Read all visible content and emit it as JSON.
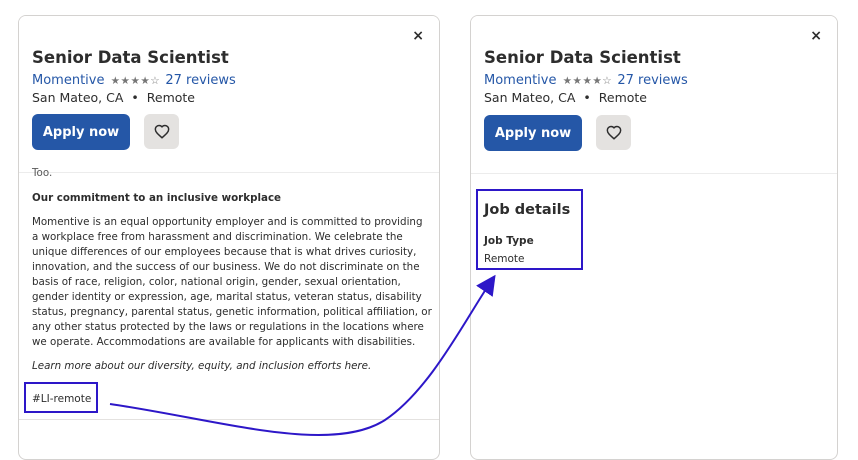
{
  "left_panel": {
    "close_label": "×",
    "job_title": "Senior Data Scientist",
    "company": "Momentive",
    "stars": "★★★★☆",
    "reviews": "27 reviews",
    "location": "San Mateo, CA",
    "separator": "•",
    "work_mode": "Remote",
    "apply_label": "Apply now",
    "body_fragment": "Too.",
    "commitment_heading": "Our commitment to an inclusive workplace",
    "commitment_text": "Momentive is an equal opportunity employer and is committed to providing a workplace free from harassment and discrimination. We celebrate the unique differences of our employees because that is what drives curiosity, innovation, and the success of our business. We do not discriminate on the basis of race, religion, color, national origin, gender, sexual orientation, gender identity or expression, age, marital status, veteran status, disability status, pregnancy, parental status, genetic information, political affiliation, or any other status protected by the laws or regulations in the locations where we operate. Accommodations are available for applicants with disabilities.",
    "learn_more": "Learn more about our diversity, equity, and inclusion efforts here.",
    "tag": "#LI-remote"
  },
  "right_panel": {
    "close_label": "×",
    "job_title": "Senior Data Scientist",
    "company": "Momentive",
    "stars": "★★★★☆",
    "reviews": "27 reviews",
    "location": "San Mateo, CA",
    "separator": "•",
    "work_mode": "Remote",
    "apply_label": "Apply now",
    "job_details_title": "Job details",
    "job_type_label": "Job Type",
    "job_type_value": "Remote"
  },
  "colors": {
    "accent_blue": "#2557a7",
    "annotation": "#2d17c8",
    "save_bg": "#e4e2e0"
  },
  "icons": {
    "close": "close-icon",
    "save": "heart-outline-icon",
    "arrow": "annotation-arrow"
  }
}
